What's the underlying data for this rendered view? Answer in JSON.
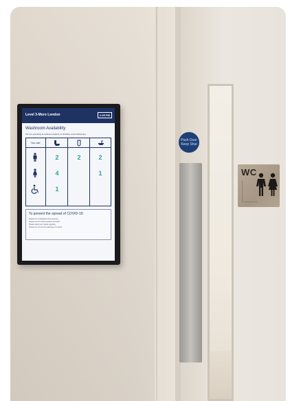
{
  "display": {
    "header_title": "Level 3-Moro London",
    "time": "1:05 PM",
    "section_title": "Washroom Availability",
    "subtitle": "We are operating at reduced capacity to facilitate social distancing",
    "table": {
      "corner_label": "You are:",
      "columns": [
        "toilet",
        "urinal",
        "sink"
      ],
      "rows": [
        {
          "icon": "man",
          "values": [
            "2",
            "2",
            "2"
          ]
        },
        {
          "icon": "woman",
          "values": [
            "4",
            "",
            "1"
          ]
        },
        {
          "icon": "accessible",
          "values": [
            "1",
            "",
            ""
          ]
        }
      ]
    },
    "covid_title": "To prevent the spread of COVID-19:",
    "covid_items": [
      "Please be considerate when queuing",
      "Please use the hand sanitiser provided",
      "Please wash your hands regularly",
      "Please do not use the washroom if unwell"
    ],
    "footer_left": "",
    "footer_right": ""
  },
  "door_sign": {
    "line1": "Push Door",
    "line2": "Keep Shut"
  },
  "wc_sign": {
    "text": "WC"
  },
  "colors": {
    "header_navy": "#1f3264",
    "count_green": "#2ca58d",
    "sign_blue": "#1e3f75"
  }
}
